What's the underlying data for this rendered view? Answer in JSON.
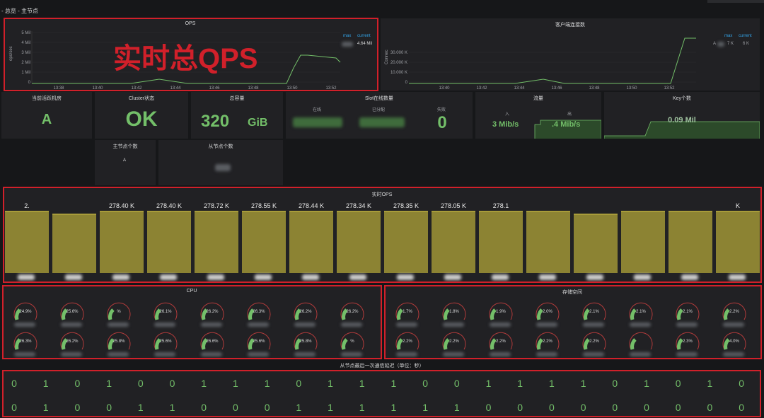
{
  "breadcrumb": "- 总览 - 主节点",
  "ops_panel": {
    "title": "OPS",
    "annotation": "实时总QPS",
    "y_ticks": [
      "5 Mil",
      "4 Mil",
      "3 Mil",
      "2 Mil",
      "1 Mil",
      "0"
    ],
    "y_unit": "ops/sec",
    "x_ticks": [
      "13:38",
      "13:40",
      "13:42",
      "13:44",
      "13:46",
      "13:48",
      "13:50",
      "13:52"
    ],
    "legend_max": "max",
    "legend_current": "current",
    "current_value": "4.64 Mil"
  },
  "clients_panel": {
    "title": "客户端连接数",
    "y_ticks": [
      "30.000 K",
      "20.000 K",
      "10.000 K",
      "0"
    ],
    "y_unit": "Connec",
    "x_ticks": [
      "13:40",
      "13:42",
      "13:44",
      "13:46",
      "13:48",
      "13:50",
      "13:52"
    ],
    "legend_max": "max",
    "legend_current": "current",
    "legend_a": "A",
    "legend_max_value": "7 K",
    "legend_current_value": "6 K"
  },
  "stats": {
    "current_machine": {
      "title": "当前活跃机房",
      "value": "A"
    },
    "cluster_status": {
      "title": "Cluster状态",
      "value": "OK"
    },
    "total_capacity": {
      "title": "总容量",
      "value": "320",
      "unit": "GiB"
    },
    "slots": {
      "title": "Slot在线数量",
      "online_label": "在线",
      "assigned_label": "已分配",
      "failed_label": "失败",
      "failed_value": "0"
    },
    "traffic": {
      "title": "流量",
      "in_label": "入",
      "out_label": "出",
      "in_value": "3 Mib/s",
      "out_value": ".4 Mib/s"
    },
    "key_count": {
      "title": "Key个数",
      "value": "0.09 Mil"
    },
    "master_count": {
      "title": "主节点个数",
      "value": "A"
    },
    "slave_count": {
      "title": "从节点个数"
    }
  },
  "realtime_ops": {
    "title": "实时OPS",
    "labels": [
      "2.",
      "",
      "278.40 K",
      "278.40 K",
      "278.72 K",
      "278.55 K",
      "278.44 K",
      "278.34 K",
      "278.35 K",
      "278.05 K",
      "278.1",
      "",
      "",
      "",
      "",
      "K"
    ]
  },
  "cpu_panel": {
    "title": "CPU",
    "row1": [
      "24.9%",
      "25.6%",
      "%",
      "26.1%",
      "26.2%",
      "26.3%",
      "26.2%",
      "26.2%"
    ],
    "row2": [
      "26.3%",
      "26.2%",
      "25.8%",
      "25.6%",
      "26.6%",
      "25.6%",
      "25.8%",
      "%"
    ]
  },
  "storage_panel": {
    "title": "存储空间",
    "row1": [
      "1.7%",
      "1.8%",
      "1.9%",
      "2.0%",
      "2.1%",
      "2.1%",
      "2.1%",
      "2.2%"
    ],
    "row2": [
      "2.2%",
      "2.2%",
      "2.2%",
      "2.2%",
      "2.2%",
      "",
      "2.3%",
      "4.0%"
    ]
  },
  "replication": {
    "title": "从节点最后一次通信延迟（单位：秒）",
    "row1": [
      "0",
      "1",
      "0",
      "1",
      "0",
      "0",
      "1",
      "1",
      "1",
      "0",
      "1",
      "1",
      "1",
      "0",
      "0",
      "1",
      "1",
      "1",
      "1",
      "0",
      "1",
      "0",
      "1",
      "0"
    ],
    "row2": [
      "0",
      "1",
      "0",
      "0",
      "1",
      "1",
      "0",
      "0",
      "0",
      "1",
      "1",
      "1",
      "1",
      "1",
      "1",
      "0",
      "0",
      "0",
      "0",
      "0",
      "0",
      "0",
      "0",
      "0"
    ]
  },
  "colors": {
    "background": "#161719",
    "panel": "#212124",
    "green": "#73bf69",
    "bar": "#8c8333",
    "annotation_red": "#d1202a"
  }
}
